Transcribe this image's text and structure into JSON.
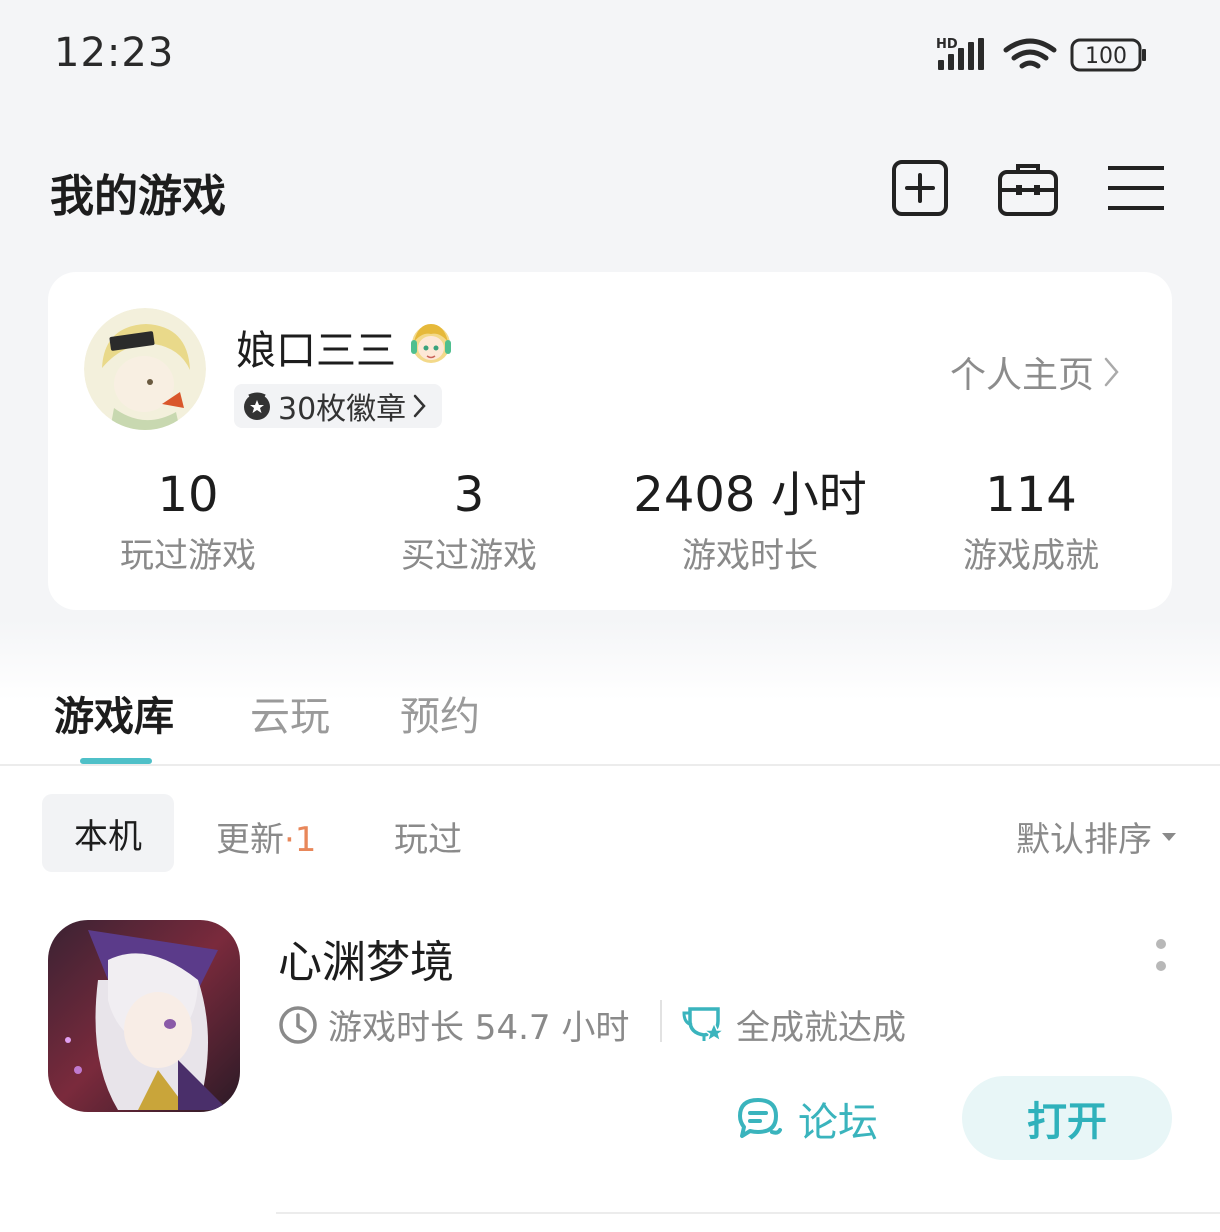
{
  "status_bar": {
    "time": "12:23",
    "battery": "100",
    "network": "HD"
  },
  "header": {
    "title": "我的游戏"
  },
  "profile": {
    "username": "娘口三三",
    "badges": "30枚徽章",
    "profile_link": "个人主页",
    "stats": [
      {
        "value": "10",
        "label": "玩过游戏"
      },
      {
        "value": "3",
        "label": "买过游戏"
      },
      {
        "value": "2408 小时",
        "label": "游戏时长"
      },
      {
        "value": "114",
        "label": "游戏成就"
      }
    ]
  },
  "tabs": [
    {
      "label": "游戏库"
    },
    {
      "label": "云玩"
    },
    {
      "label": "预约"
    }
  ],
  "filters": {
    "items": [
      "本机",
      "更新",
      "玩过"
    ],
    "update_count": "·1",
    "sort": "默认排序"
  },
  "games": [
    {
      "title": "心渊梦境",
      "playtime": "游戏时长 54.7 小时",
      "achievement": "全成就达成",
      "forum": "论坛",
      "open": "打开"
    }
  ],
  "colors": {
    "accent": "#4fc0c8",
    "update_badge": "#e8875a"
  }
}
